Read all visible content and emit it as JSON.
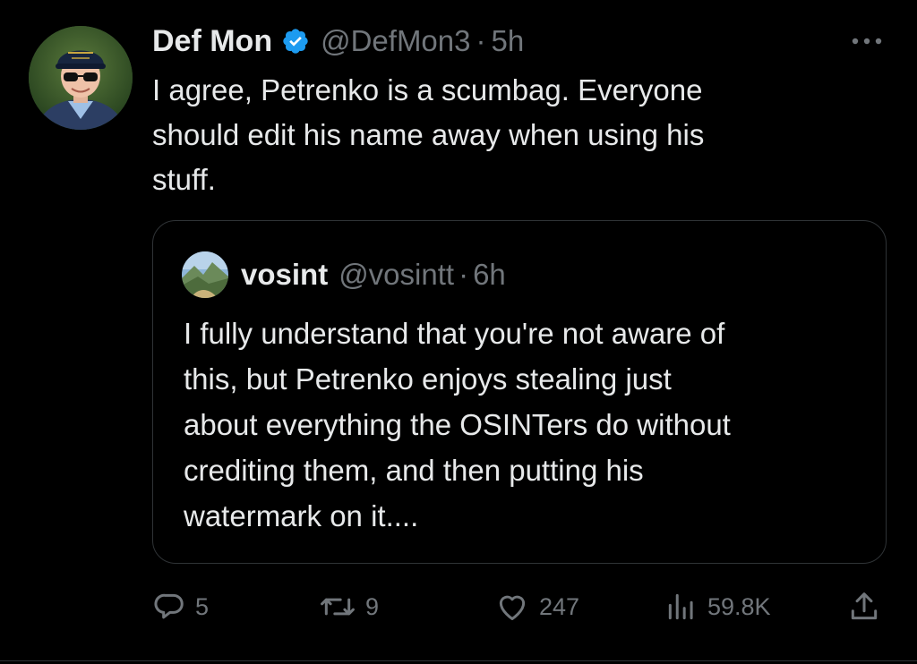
{
  "tweet": {
    "author": {
      "display_name": "Def Mon",
      "handle": "@DefMon3",
      "separator": "·",
      "time": "5h",
      "verified_icon": "verified-badge-icon",
      "avatar_icon": "profile-photo-avatar"
    },
    "text_lines": [
      "I agree, Petrenko is a scumbag. Everyone",
      "should edit his name away when using his",
      "stuff."
    ],
    "more_icon": "more-options-icon",
    "quote": {
      "display_name": "vosint",
      "handle": "@vosintt",
      "separator": "·",
      "time": "6h",
      "avatar_icon": "landscape-avatar",
      "text_lines": [
        "I fully understand that you're not aware of",
        "this, but Petrenko enjoys stealing just",
        "about everything the OSINTers do without",
        "crediting them, and then putting his",
        "watermark on it...."
      ]
    },
    "actions": {
      "reply": {
        "icon": "reply-icon",
        "count": "5"
      },
      "retweet": {
        "icon": "retweet-icon",
        "count": "9"
      },
      "like": {
        "icon": "heart-icon",
        "count": "247"
      },
      "views": {
        "icon": "views-chart-icon",
        "count": "59.8K"
      },
      "share": {
        "icon": "share-icon"
      }
    }
  },
  "colors": {
    "background": "#000000",
    "primary_text": "#e7e9ea",
    "secondary_text": "#71767b",
    "border": "#2f3336",
    "verified_blue": "#1d9bf0"
  }
}
